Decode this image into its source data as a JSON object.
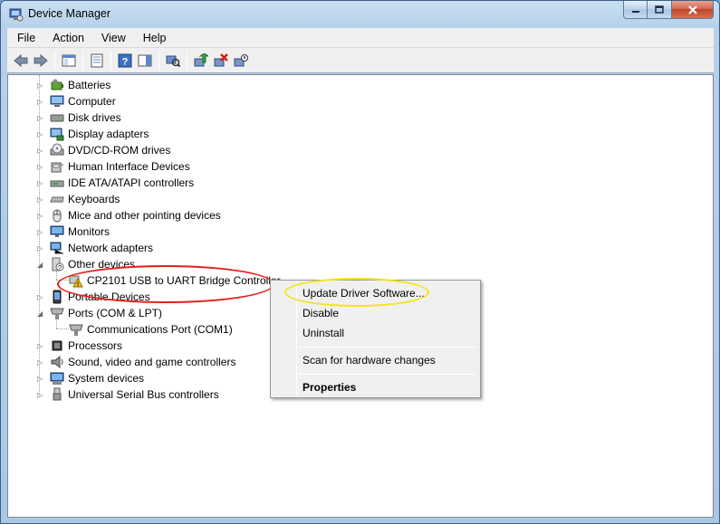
{
  "window": {
    "title": "Device Manager"
  },
  "menubar": {
    "items": [
      "File",
      "Action",
      "View",
      "Help"
    ]
  },
  "toolbar": {
    "buttons": [
      "back-arrow-icon",
      "forward-arrow-icon",
      "show-hide-tree-icon",
      "properties-icon",
      "help-icon",
      "scan-hardware-icon",
      "update-driver-icon",
      "uninstall-icon",
      "disable-device-icon"
    ]
  },
  "tree": {
    "categories": [
      {
        "label": "Batteries",
        "icon": "battery-icon",
        "expanded": false
      },
      {
        "label": "Computer",
        "icon": "computer-icon",
        "expanded": false
      },
      {
        "label": "Disk drives",
        "icon": "disk-drive-icon",
        "expanded": false
      },
      {
        "label": "Display adapters",
        "icon": "display-adapter-icon",
        "expanded": false
      },
      {
        "label": "DVD/CD-ROM drives",
        "icon": "dvd-drive-icon",
        "expanded": false
      },
      {
        "label": "Human Interface Devices",
        "icon": "hid-icon",
        "expanded": false
      },
      {
        "label": "IDE ATA/ATAPI controllers",
        "icon": "ide-controller-icon",
        "expanded": false
      },
      {
        "label": "Keyboards",
        "icon": "keyboard-icon",
        "expanded": false
      },
      {
        "label": "Mice and other pointing devices",
        "icon": "mouse-icon",
        "expanded": false
      },
      {
        "label": "Monitors",
        "icon": "monitor-icon",
        "expanded": false
      },
      {
        "label": "Network adapters",
        "icon": "network-adapter-icon",
        "expanded": false
      },
      {
        "label": "Other devices",
        "icon": "other-devices-icon",
        "expanded": true,
        "children": [
          {
            "label": "CP2101 USB to UART Bridge Controller",
            "icon": "warning-device-icon"
          }
        ]
      },
      {
        "label": "Portable Devices",
        "icon": "portable-device-icon",
        "expanded": false
      },
      {
        "label": "Ports (COM & LPT)",
        "icon": "port-icon",
        "expanded": true,
        "children": [
          {
            "label": "Communications Port (COM1)",
            "icon": "port-icon"
          }
        ]
      },
      {
        "label": "Processors",
        "icon": "processor-icon",
        "expanded": false
      },
      {
        "label": "Sound, video and game controllers",
        "icon": "sound-icon",
        "expanded": false
      },
      {
        "label": "System devices",
        "icon": "system-devices-icon",
        "expanded": false
      },
      {
        "label": "Universal Serial Bus controllers",
        "icon": "usb-icon",
        "expanded": false
      }
    ]
  },
  "context_menu": {
    "update_driver": "Update Driver Software...",
    "disable": "Disable",
    "uninstall": "Uninstall",
    "scan": "Scan for hardware changes",
    "properties": "Properties"
  },
  "annotations": {
    "device_highlight_color": "#e3211c",
    "menu_highlight_color": "#f5e31a"
  }
}
